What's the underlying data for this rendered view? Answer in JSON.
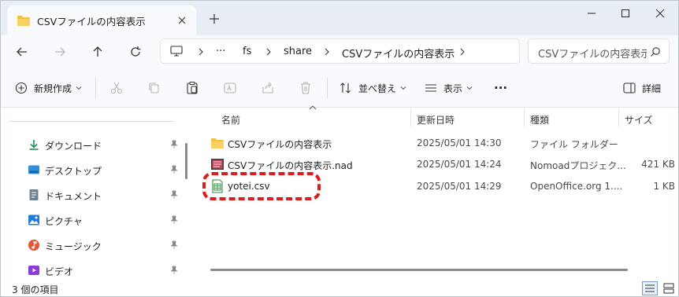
{
  "window": {
    "tab_title": "CSVファイルの内容表示"
  },
  "address": {
    "ellipsis": "···",
    "crumbs": [
      "fs",
      "share",
      "CSVファイルの内容表示"
    ]
  },
  "search": {
    "placeholder": "CSVファイルの内容表示の検索"
  },
  "toolbar": {
    "new_label": "新規作成",
    "sort_label": "並べ替え",
    "view_label": "表示",
    "more_label": "···",
    "details_label": "詳細"
  },
  "sidebar": {
    "items": [
      {
        "label": "ダウンロード",
        "icon": "download-icon"
      },
      {
        "label": "デスクトップ",
        "icon": "desktop-icon"
      },
      {
        "label": "ドキュメント",
        "icon": "document-icon"
      },
      {
        "label": "ピクチャ",
        "icon": "pictures-icon"
      },
      {
        "label": "ミュージック",
        "icon": "music-icon"
      },
      {
        "label": "ビデオ",
        "icon": "video-icon"
      }
    ]
  },
  "filelist": {
    "columns": {
      "name": "名前",
      "modified": "更新日時",
      "type": "種類",
      "size": "サイズ"
    },
    "rows": [
      {
        "name": "CSVファイルの内容表示",
        "modified": "2025/05/01 14:30",
        "type": "ファイル フォルダー",
        "size": "",
        "icon": "folder-icon"
      },
      {
        "name": "CSVファイルの内容表示.nad",
        "modified": "2025/05/01 14:24",
        "type": "Nomoadプロジェク...",
        "size": "421 KB",
        "icon": "nad-file-icon"
      },
      {
        "name": "yotei.csv",
        "modified": "2025/05/01 14:29",
        "type": "OpenOffice.org 1....",
        "size": "1 KB",
        "icon": "csv-file-icon"
      }
    ]
  },
  "status": {
    "item_count": "3 個の項目"
  },
  "colors": {
    "titlebar_bg": "#e9eef6",
    "folder": "#f4c142",
    "highlight": "#e01b1b",
    "csv_green": "#2e8b3a"
  }
}
